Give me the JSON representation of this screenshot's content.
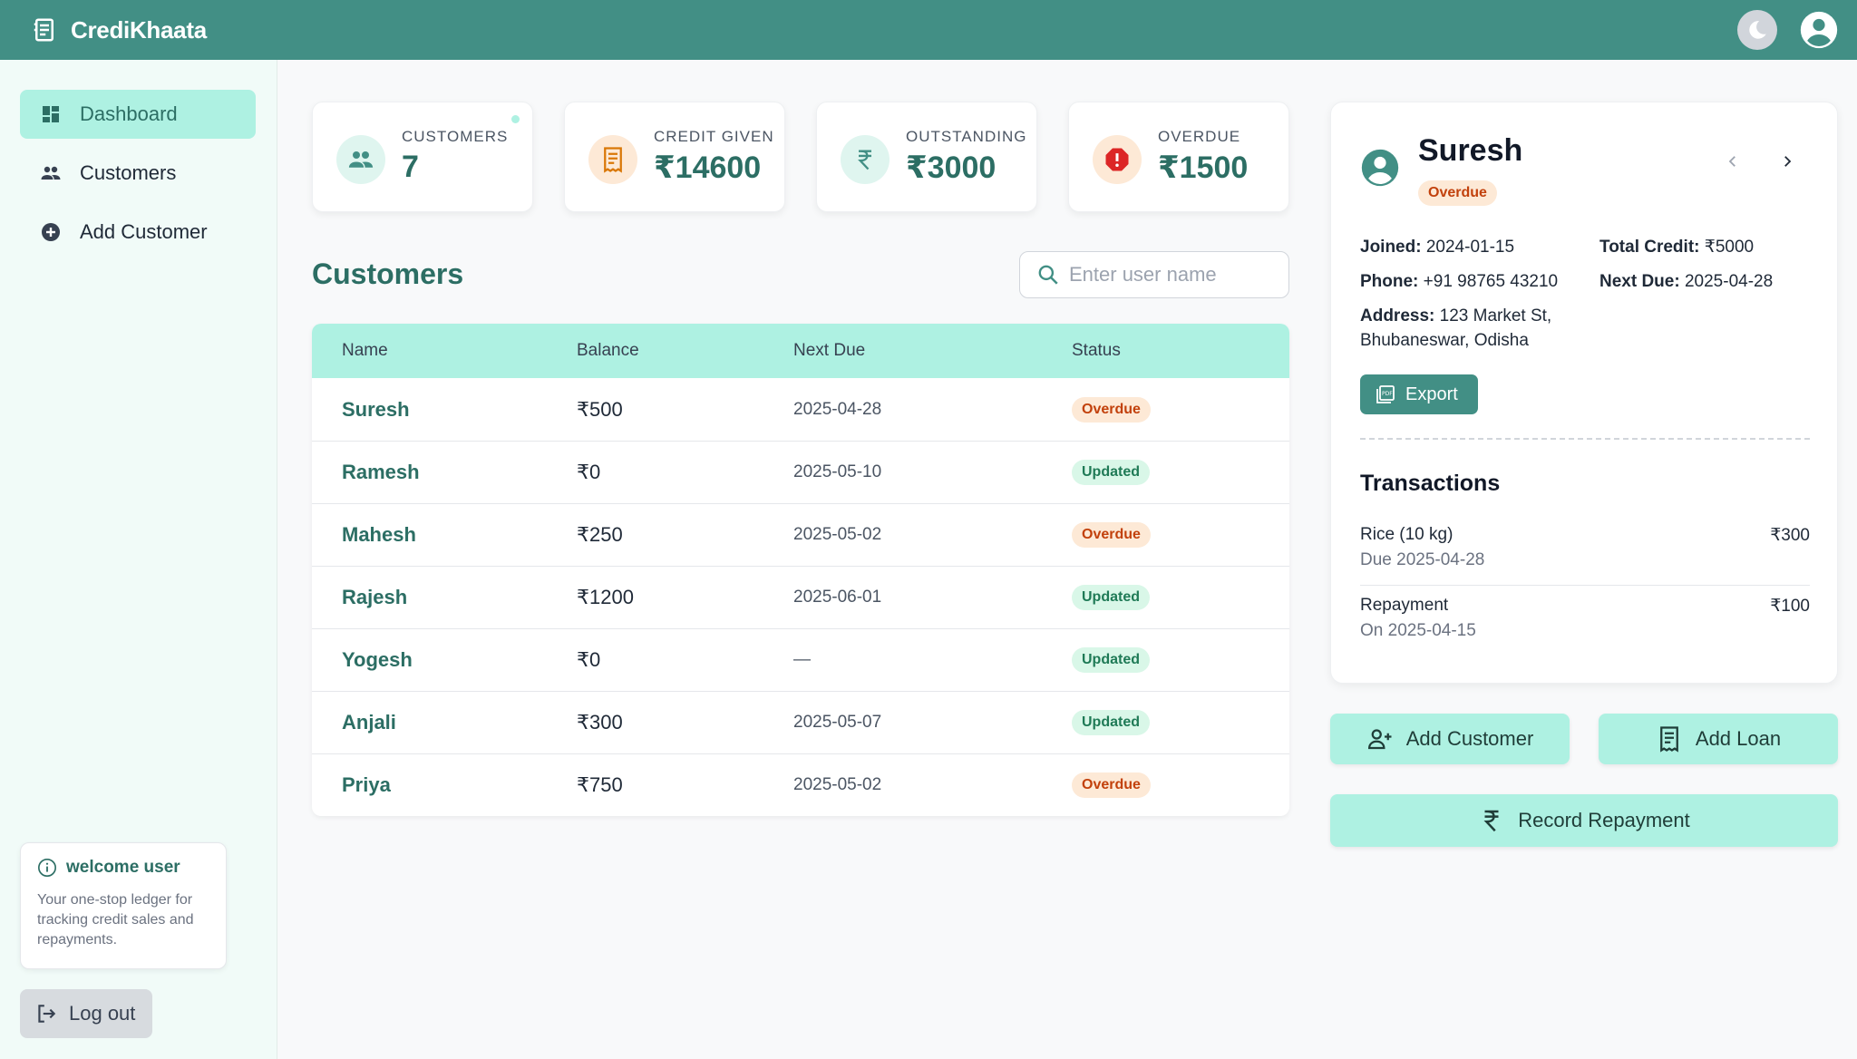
{
  "app": {
    "title": "CrediKhaata"
  },
  "sidebar": {
    "items": [
      {
        "label": "Dashboard",
        "icon": "dashboard-icon",
        "active": true
      },
      {
        "label": "Customers",
        "icon": "people-icon",
        "active": false
      },
      {
        "label": "Add Customer",
        "icon": "add-circle-icon",
        "active": false
      }
    ],
    "welcome": {
      "title": "welcome user",
      "text": "Your one-stop ledger for tracking credit sales and repayments."
    },
    "logout_label": "Log out"
  },
  "stats": [
    {
      "label": "CUSTOMERS",
      "value": "7",
      "icon": "people-icon",
      "icon_bg": "#dff5ef"
    },
    {
      "label": "CREDIT GIVEN",
      "value": "₹14600",
      "icon": "receipt-icon",
      "icon_bg": "#fde9d6"
    },
    {
      "label": "OUTSTANDING",
      "value": "₹3000",
      "icon": "rupee-icon",
      "icon_bg": "#dff5ef"
    },
    {
      "label": "OVERDUE",
      "value": "₹1500",
      "icon": "alert-icon",
      "icon_bg": "#fde9d6"
    }
  ],
  "customers": {
    "title": "Customers",
    "search_placeholder": "Enter user name",
    "columns": [
      "Name",
      "Balance",
      "Next Due",
      "Status"
    ],
    "rows": [
      {
        "name": "Suresh",
        "balance": "₹500",
        "next_due": "2025-04-28",
        "status": "Overdue"
      },
      {
        "name": "Ramesh",
        "balance": "₹0",
        "next_due": "2025-05-10",
        "status": "Updated"
      },
      {
        "name": "Mahesh",
        "balance": "₹250",
        "next_due": "2025-05-02",
        "status": "Overdue"
      },
      {
        "name": "Rajesh",
        "balance": "₹1200",
        "next_due": "2025-06-01",
        "status": "Updated"
      },
      {
        "name": "Yogesh",
        "balance": "₹0",
        "next_due": "—",
        "status": "Updated"
      },
      {
        "name": "Anjali",
        "balance": "₹300",
        "next_due": "2025-05-07",
        "status": "Updated"
      },
      {
        "name": "Priya",
        "balance": "₹750",
        "next_due": "2025-05-02",
        "status": "Overdue"
      }
    ]
  },
  "detail": {
    "name": "Suresh",
    "status": "Overdue",
    "joined_label": "Joined:",
    "joined": "2024-01-15",
    "total_credit_label": "Total Credit:",
    "total_credit": "₹5000",
    "phone_label": "Phone:",
    "phone": "+91 98765 43210",
    "next_due_label": "Next Due:",
    "next_due": "2025-04-28",
    "address_label": "Address:",
    "address_line1": "123 Market St,",
    "address_line2": "Bhubaneswar, Odisha",
    "export_label": "Export",
    "transactions_title": "Transactions",
    "transactions": [
      {
        "title": "Rice (10 kg)",
        "sub": "Due 2025-04-28",
        "amount": "₹300"
      },
      {
        "title": "Repayment",
        "sub": "On 2025-04-15",
        "amount": "₹100"
      }
    ]
  },
  "actions": {
    "add_customer": "Add Customer",
    "add_loan": "Add Loan",
    "record_repayment": "Record Repayment"
  },
  "colors": {
    "brand": "#428f85",
    "accent_light": "#aef1e2",
    "text_accent": "#2c6e64",
    "overdue": "#c2410c",
    "updated": "#1f7a56"
  }
}
